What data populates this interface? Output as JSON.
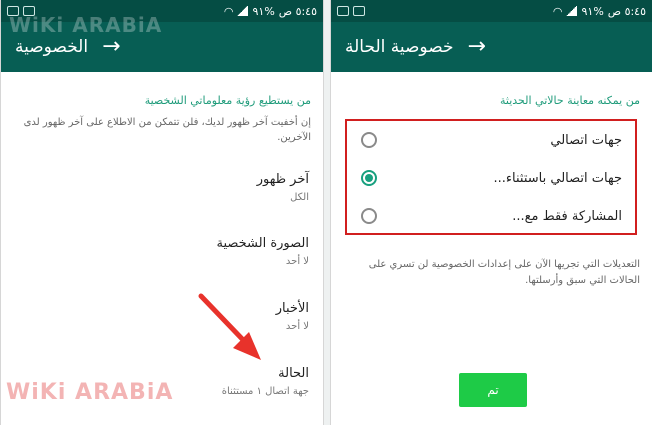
{
  "left": {
    "status": {
      "time": "٥:٤٥ ص",
      "battery": "%٩١"
    },
    "appbar": {
      "title": "الخصوصية"
    },
    "section_title": "من يستطيع رؤية معلوماتي الشخصية",
    "description": "إن أخفيت آخر ظهور لديك، فلن تتمكن من الاطلاع على آخر ظهور لدى الآخرين.",
    "settings": [
      {
        "label": "آخر ظهور",
        "value": "الكل"
      },
      {
        "label": "الصورة الشخصية",
        "value": "لا أحد"
      },
      {
        "label": "الأخبار",
        "value": "لا أحد"
      },
      {
        "label": "الحالة",
        "value": "جهة اتصال ١ مستثناة"
      }
    ]
  },
  "right": {
    "status": {
      "time": "٥:٤٥ ص",
      "battery": "%٩١"
    },
    "appbar": {
      "title": "خصوصية الحالة"
    },
    "section_title": "من يمكنه معاينة حالاتي الحديثة",
    "options": [
      {
        "label": "جهات اتصالي",
        "selected": false
      },
      {
        "label": "جهات اتصالي باستثناء...",
        "selected": true
      },
      {
        "label": "المشاركة فقط مع...",
        "selected": false
      }
    ],
    "note": "التعديلات التي تجريها الآن على إعدادات الخصوصية لن تسري على الحالات التي سبق وأرسلتها.",
    "done_button": "تم"
  },
  "watermark": {
    "text": "WiKi ARABiA"
  },
  "colors": {
    "appbar": "#075e54",
    "statusbar": "#054d44",
    "accent": "#1e9b7a",
    "radio": "#18a07f",
    "highlight_box": "#d11f1f",
    "arrow": "#e8322b",
    "button": "#1ecb47"
  }
}
